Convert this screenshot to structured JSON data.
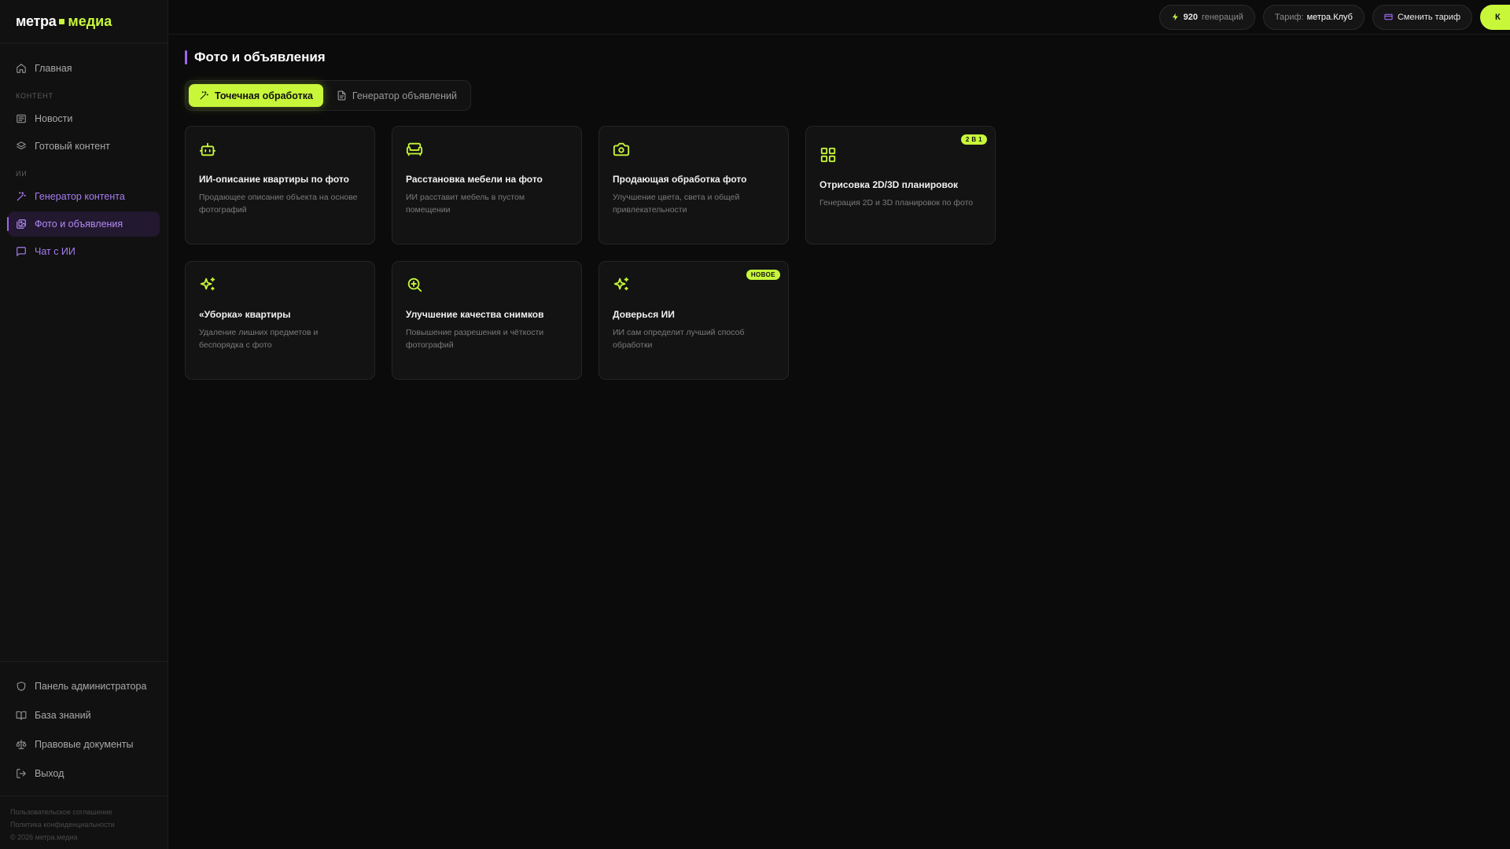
{
  "logo": {
    "brand": "метра",
    "accent": "медиа"
  },
  "sidebar": {
    "home": "Главная",
    "section_content": "КОНТЕНТ",
    "news": "Новости",
    "ready_content": "Готовый контент",
    "section_ai": "ИИ",
    "generator": "Генератор контента",
    "photos": "Фото и объявления",
    "chat": "Чат с ИИ",
    "bottom": {
      "admin": "Панель администратора",
      "knowledge": "База знаний",
      "legal": "Правовые документы",
      "logout": "Выход"
    },
    "footer": {
      "terms": "Пользовательское соглашение",
      "privacy": "Политика конфиденциальности",
      "copyright": "© 2026 метра.медиа"
    }
  },
  "topbar": {
    "generations_count": "920",
    "generations_label": "генераций",
    "tariff_label": "Тариф:",
    "tariff_value": "метра.Клуб",
    "change_tariff": "Сменить тариф",
    "buy_label": "К"
  },
  "page": {
    "title": "Фото и объявления",
    "tabs": [
      "Точечная обработка",
      "Генератор объявлений"
    ],
    "cards": [
      {
        "title": "ИИ-описание квартиры по фото",
        "desc": "Продающее описание объекта на основе фотографий",
        "icon": "robot-icon"
      },
      {
        "title": "Расстановка мебели на фото",
        "desc": "ИИ расставит мебель в пустом помещении",
        "icon": "sofa-icon"
      },
      {
        "title": "Продающая обработка фото",
        "desc": "Улучшение цвета, света и общей привлекательности",
        "icon": "camera-icon"
      },
      {
        "title": "Отрисовка 2D/3D планировок",
        "desc": "Генерация 2D и 3D планировок по фото",
        "icon": "grid-icon",
        "badge": "2 В 1"
      },
      {
        "title": "«Уборка» квартиры",
        "desc": "Удаление лишних предметов и беспорядка с фото",
        "icon": "sparkles-icon"
      },
      {
        "title": "Улучшение качества снимков",
        "desc": "Повышение разрешения и чёткости фотографий",
        "icon": "zoom-in-icon"
      },
      {
        "title": "Доверься ИИ",
        "desc": "ИИ сам определит лучший способ обработки",
        "icon": "sparkles-icon",
        "badge": "НОВОЕ"
      }
    ]
  },
  "colors": {
    "accent": "#c8f73a",
    "purple": "#a066f0",
    "background": "#0b0b0b"
  }
}
